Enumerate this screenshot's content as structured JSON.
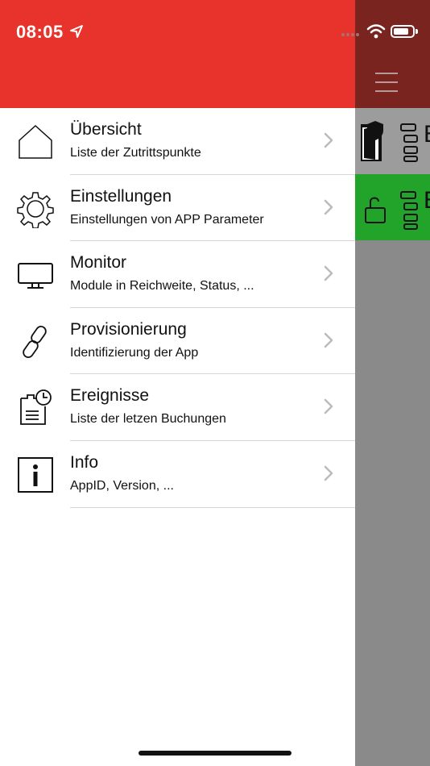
{
  "status_bar": {
    "time": "08:05"
  },
  "colors": {
    "header_red": "#e8322c",
    "dimmed_header": "#7a2420",
    "active_row_green": "#22a32a"
  },
  "menu": {
    "items": [
      {
        "icon": "house-icon",
        "title": "Übersicht",
        "subtitle": "Liste der Zutrittspunkte"
      },
      {
        "icon": "gear-icon",
        "title": "Einstellungen",
        "subtitle": "Einstellungen von APP Parameter"
      },
      {
        "icon": "monitor-icon",
        "title": "Monitor",
        "subtitle": "Module in Reichweite, Status, ..."
      },
      {
        "icon": "link-icon",
        "title": "Provisionierung",
        "subtitle": "Identifizierung der App"
      },
      {
        "icon": "clipboard-clock-icon",
        "title": "Ereignisse",
        "subtitle": "Liste der letzen Buchungen"
      },
      {
        "icon": "info-icon",
        "title": "Info",
        "subtitle": "AppID, Version, ..."
      }
    ]
  },
  "background_list": {
    "rows": [
      {
        "letter": "E"
      },
      {
        "letter": "E"
      }
    ]
  }
}
